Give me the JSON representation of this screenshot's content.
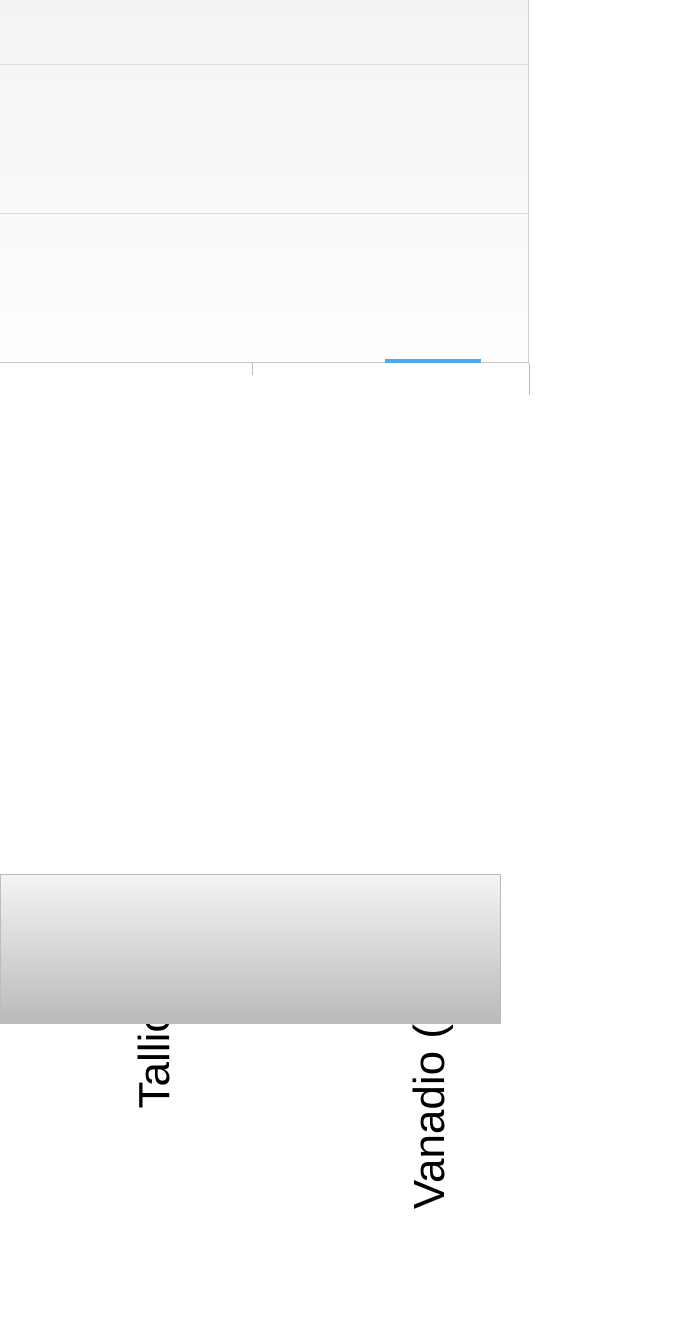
{
  "chart_data": {
    "type": "bar",
    "categories": [
      "Tallio (Tl)",
      "Vanadio (V)"
    ],
    "values": [
      0,
      1
    ],
    "title": "",
    "xlabel": "",
    "ylabel": "",
    "ylim": [
      0,
      100
    ]
  },
  "xaxis": {
    "labels": [
      "Tallio (Tl)",
      "Vanadio (V)"
    ]
  }
}
